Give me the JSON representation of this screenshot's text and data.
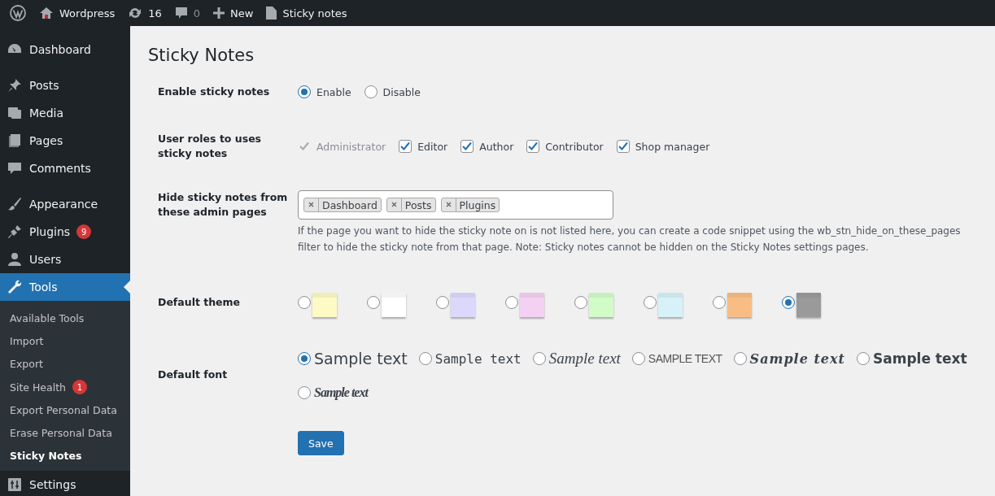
{
  "admin_bar": {
    "items": [
      {
        "kind": "logo"
      },
      {
        "kind": "home",
        "label": "Wordpress"
      },
      {
        "kind": "updates",
        "label": "16"
      },
      {
        "kind": "comments",
        "label": "0"
      },
      {
        "kind": "new",
        "label": "New"
      },
      {
        "kind": "page",
        "label": "Sticky notes"
      }
    ]
  },
  "sidebar": {
    "items": [
      {
        "kind": "dashboard",
        "label": "Dashboard",
        "selected": false,
        "gap": true
      },
      {
        "kind": "pin",
        "label": "Posts",
        "selected": false,
        "gap": true
      },
      {
        "kind": "media",
        "label": "Media",
        "selected": false
      },
      {
        "kind": "pages",
        "label": "Pages",
        "selected": false
      },
      {
        "kind": "comments",
        "label": "Comments",
        "selected": false
      },
      {
        "kind": "appearance",
        "label": "Appearance",
        "selected": false,
        "gap": true
      },
      {
        "kind": "plugins",
        "label": "Plugins",
        "badge": "9",
        "selected": false
      },
      {
        "kind": "users",
        "label": "Users",
        "selected": false
      },
      {
        "kind": "tools",
        "label": "Tools",
        "selected": true,
        "children": [
          {
            "label": "Available Tools",
            "selected": false
          },
          {
            "label": "Import",
            "selected": false
          },
          {
            "label": "Export",
            "selected": false
          },
          {
            "label": "Site Health",
            "badge": "1",
            "selected": false
          },
          {
            "label": "Export Personal Data",
            "selected": false
          },
          {
            "label": "Erase Personal Data",
            "selected": false
          },
          {
            "label": "Sticky Notes",
            "selected": true
          }
        ]
      },
      {
        "kind": "settings",
        "label": "Settings",
        "selected": false
      }
    ]
  },
  "page": {
    "title": "Sticky Notes",
    "enable": {
      "label": "Enable sticky notes",
      "options": [
        {
          "label": "Enable",
          "selected": true
        },
        {
          "label": "Disable",
          "selected": false
        }
      ]
    },
    "roles": {
      "label": "User roles to uses sticky notes",
      "options": [
        {
          "label": "Administrator",
          "checked": true,
          "disabled": true
        },
        {
          "label": "Editor",
          "checked": true,
          "disabled": false
        },
        {
          "label": "Author",
          "checked": true,
          "disabled": false
        },
        {
          "label": "Contributor",
          "checked": true,
          "disabled": false
        },
        {
          "label": "Shop manager",
          "checked": true,
          "disabled": false
        }
      ]
    },
    "hide": {
      "label": "Hide sticky notes from these admin pages",
      "tags": [
        "Dashboard",
        "Posts",
        "Plugins"
      ],
      "description": "If the page you want to hide the sticky note on is not listed here, you can create a code snippet using the wb_stn_hide_on_these_pages filter to hide the sticky note from that page. Note: Sticky notes cannot be hidden on the Sticky Notes settings pages."
    },
    "theme": {
      "label": "Default theme",
      "options": [
        {
          "color": "#fdfac6",
          "selected": false
        },
        {
          "color": "#ffffff",
          "selected": false
        },
        {
          "color": "#dcd8fb",
          "selected": false
        },
        {
          "color": "#f4d0f2",
          "selected": false
        },
        {
          "color": "#d1fcc8",
          "selected": false
        },
        {
          "color": "#d6f1f8",
          "selected": false
        },
        {
          "color": "#f8bd84",
          "selected": false
        },
        {
          "color": "#9a9a9a",
          "selected": true
        }
      ]
    },
    "font": {
      "label": "Default font",
      "options": [
        {
          "kind": "sans",
          "label": "Sample text",
          "selected": true
        },
        {
          "kind": "hand",
          "label": "Sample text",
          "selected": false
        },
        {
          "kind": "script",
          "label": "Sample text",
          "selected": false
        },
        {
          "kind": "caps",
          "label": "SAMPLE TEXT",
          "selected": false
        },
        {
          "kind": "brush",
          "label": "Sample text",
          "selected": false
        },
        {
          "kind": "comic",
          "label": "Sample text",
          "selected": false
        },
        {
          "kind": "bold-script",
          "label": "Sample text",
          "selected": false
        }
      ]
    },
    "save": "Save"
  }
}
